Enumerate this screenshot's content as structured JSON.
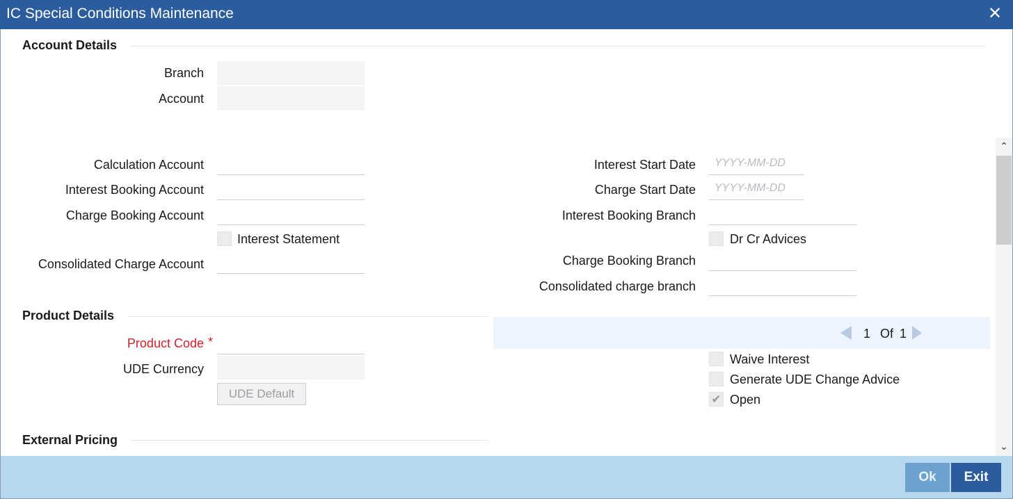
{
  "window": {
    "title": "IC Special Conditions Maintenance"
  },
  "account_details": {
    "heading": "Account Details",
    "branch_label": "Branch",
    "branch_value": "",
    "account_label": "Account",
    "account_value": ""
  },
  "left_fields": {
    "calculation_account_label": "Calculation Account",
    "interest_booking_account_label": "Interest Booking Account",
    "charge_booking_account_label": "Charge Booking Account",
    "interest_statement_label": "Interest Statement",
    "consolidated_charge_account_label": "Consolidated Charge Account"
  },
  "right_fields": {
    "interest_start_date_label": "Interest Start Date",
    "interest_start_date_placeholder": "YYYY-MM-DD",
    "charge_start_date_label": "Charge Start Date",
    "charge_start_date_placeholder": "YYYY-MM-DD",
    "interest_booking_branch_label": "Interest Booking Branch",
    "dr_cr_advices_label": "Dr Cr Advices",
    "charge_booking_branch_label": "Charge Booking Branch",
    "consolidated_charge_branch_label": "Consolidated charge branch"
  },
  "product_details": {
    "heading": "Product Details",
    "product_code_label": "Product Code",
    "required_marker": "*",
    "ude_currency_label": "UDE Currency",
    "ude_default_button": "UDE Default"
  },
  "pager": {
    "current": "1",
    "of_label": "Of",
    "total": "1"
  },
  "product_options": {
    "waive_interest_label": "Waive Interest",
    "waive_interest_checked": false,
    "generate_ude_label": "Generate UDE Change Advice",
    "generate_ude_checked": false,
    "open_label": "Open",
    "open_checked": true,
    "open_tick": "✔"
  },
  "external_pricing": {
    "heading": "External Pricing"
  },
  "footer": {
    "ok_label": "Ok",
    "exit_label": "Exit"
  },
  "icons": {
    "close": "✕",
    "scroll_up": "⌃",
    "scroll_down": "⌄"
  },
  "colors": {
    "titlebar": "#2b5d9e",
    "footer": "#b7d7ee",
    "required": "#d0212c",
    "exit_button": "#2b5d9e",
    "ok_button": "#6da2cf"
  }
}
